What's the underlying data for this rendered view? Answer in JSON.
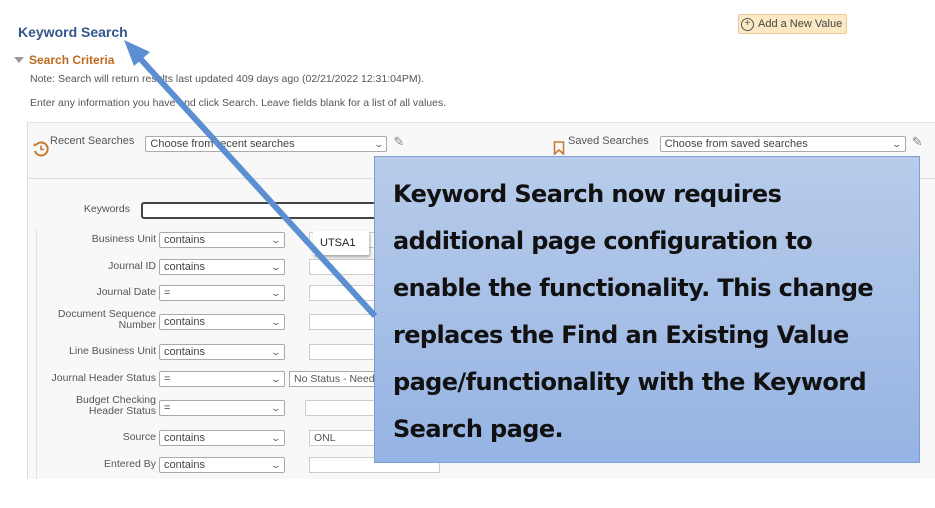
{
  "page": {
    "title": "Keyword Search",
    "add_new_value": "Add a New Value",
    "search_criteria_label": "Search Criteria",
    "note": "Note: Search will return results last updated 409 days ago (02/21/2022 12:31:04PM).",
    "instructions": "Enter any information you have and click Search. Leave fields blank for a list of all values."
  },
  "recent_searches": {
    "label": "Recent Searches",
    "placeholder": "Choose from recent searches",
    "icon": "history-clock-icon"
  },
  "saved_searches": {
    "label": "Saved Searches",
    "placeholder": "Choose from saved searches",
    "icon": "bookmark-icon"
  },
  "keywords": {
    "label": "Keywords",
    "value": ""
  },
  "fields": [
    {
      "label": "Business Unit",
      "operator": "contains",
      "value": ""
    },
    {
      "label": "Journal ID",
      "operator": "contains",
      "value": ""
    },
    {
      "label": "Journal Date",
      "operator": "=",
      "value": ""
    },
    {
      "label": "Document Sequence Number",
      "operator": "contains",
      "value": ""
    },
    {
      "label": "Line Business Unit",
      "operator": "contains",
      "value": ""
    },
    {
      "label": "Journal Header Status",
      "operator": "=",
      "value": "No Status - Needs to be Edited"
    },
    {
      "label": "Budget Checking Header Status",
      "operator": "=",
      "value": ""
    },
    {
      "label": "Source",
      "operator": "contains",
      "value": "ONL"
    },
    {
      "label": "Entered By",
      "operator": "contains",
      "value": ""
    }
  ],
  "autocomplete": {
    "suggestion": "UTSA1"
  },
  "callout": {
    "text": "Keyword Search now requires additional page configuration to enable the functionality.  This change replaces the Find an Existing Value page/functionality with the Keyword Search page.",
    "background": "#a9c2e8",
    "arrow_color": "#5b8fd1"
  }
}
